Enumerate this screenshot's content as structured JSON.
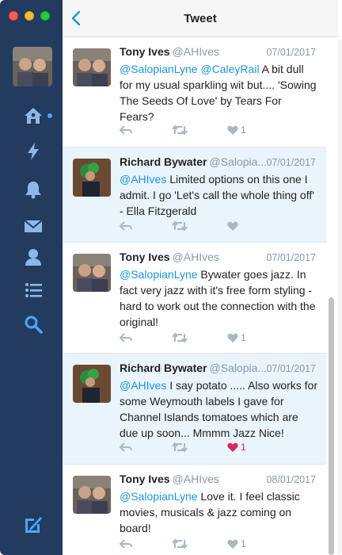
{
  "header": {
    "title": "Tweet"
  },
  "tweets": [
    {
      "name": "Tony Ives",
      "handle": "@AHIves",
      "date": "07/01/2017",
      "mentions": "@SalopianLyne @CaleyRail",
      "text": " A bit dull for my usual sparkling wit but.... 'Sowing The Seeds Of Love' by Tears For Fears?",
      "likes": "1",
      "liked": false
    },
    {
      "name": "Richard Bywater",
      "handle": "@Salopia...",
      "date": "07/01/2017",
      "mentions": "@AHIves",
      "text": " Limited options on this one I admit. I go 'Let's call the whole thing off' - Ella Fitzgerald",
      "likes": "",
      "liked": false
    },
    {
      "name": "Tony Ives",
      "handle": "@AHIves",
      "date": "07/01/2017",
      "mentions": "@SalopianLyne",
      "text": " Bywater goes jazz. In fact very jazz with it's free form styling - hard to work out the connection with the original!",
      "likes": "1",
      "liked": false
    },
    {
      "name": "Richard Bywater",
      "handle": "@Salopia...",
      "date": "07/01/2017",
      "mentions": "@AHIves",
      "text": " I say potato ..... Also works for some Weymouth labels I gave for Channel Islands tomatoes which are due up soon... Mmmm Jazz Nice!",
      "likes": "1",
      "liked": true
    },
    {
      "name": "Tony Ives",
      "handle": "@AHIves",
      "date": "08/01/2017",
      "mentions": "@SalopianLyne",
      "text": " Love it. I feel classic movies, musicals & jazz coming on board!",
      "likes": "1",
      "liked": false
    }
  ],
  "sidebar": {
    "icons": [
      "home-icon",
      "lightning-icon",
      "bell-icon",
      "envelope-icon",
      "profile-icon",
      "list-icon",
      "search-icon",
      "compose-icon"
    ]
  },
  "colors": {
    "sidebar": "#233b5e",
    "accent": "#1b95e0",
    "highlight": "#e9f4fd",
    "like": "#e0245e"
  }
}
